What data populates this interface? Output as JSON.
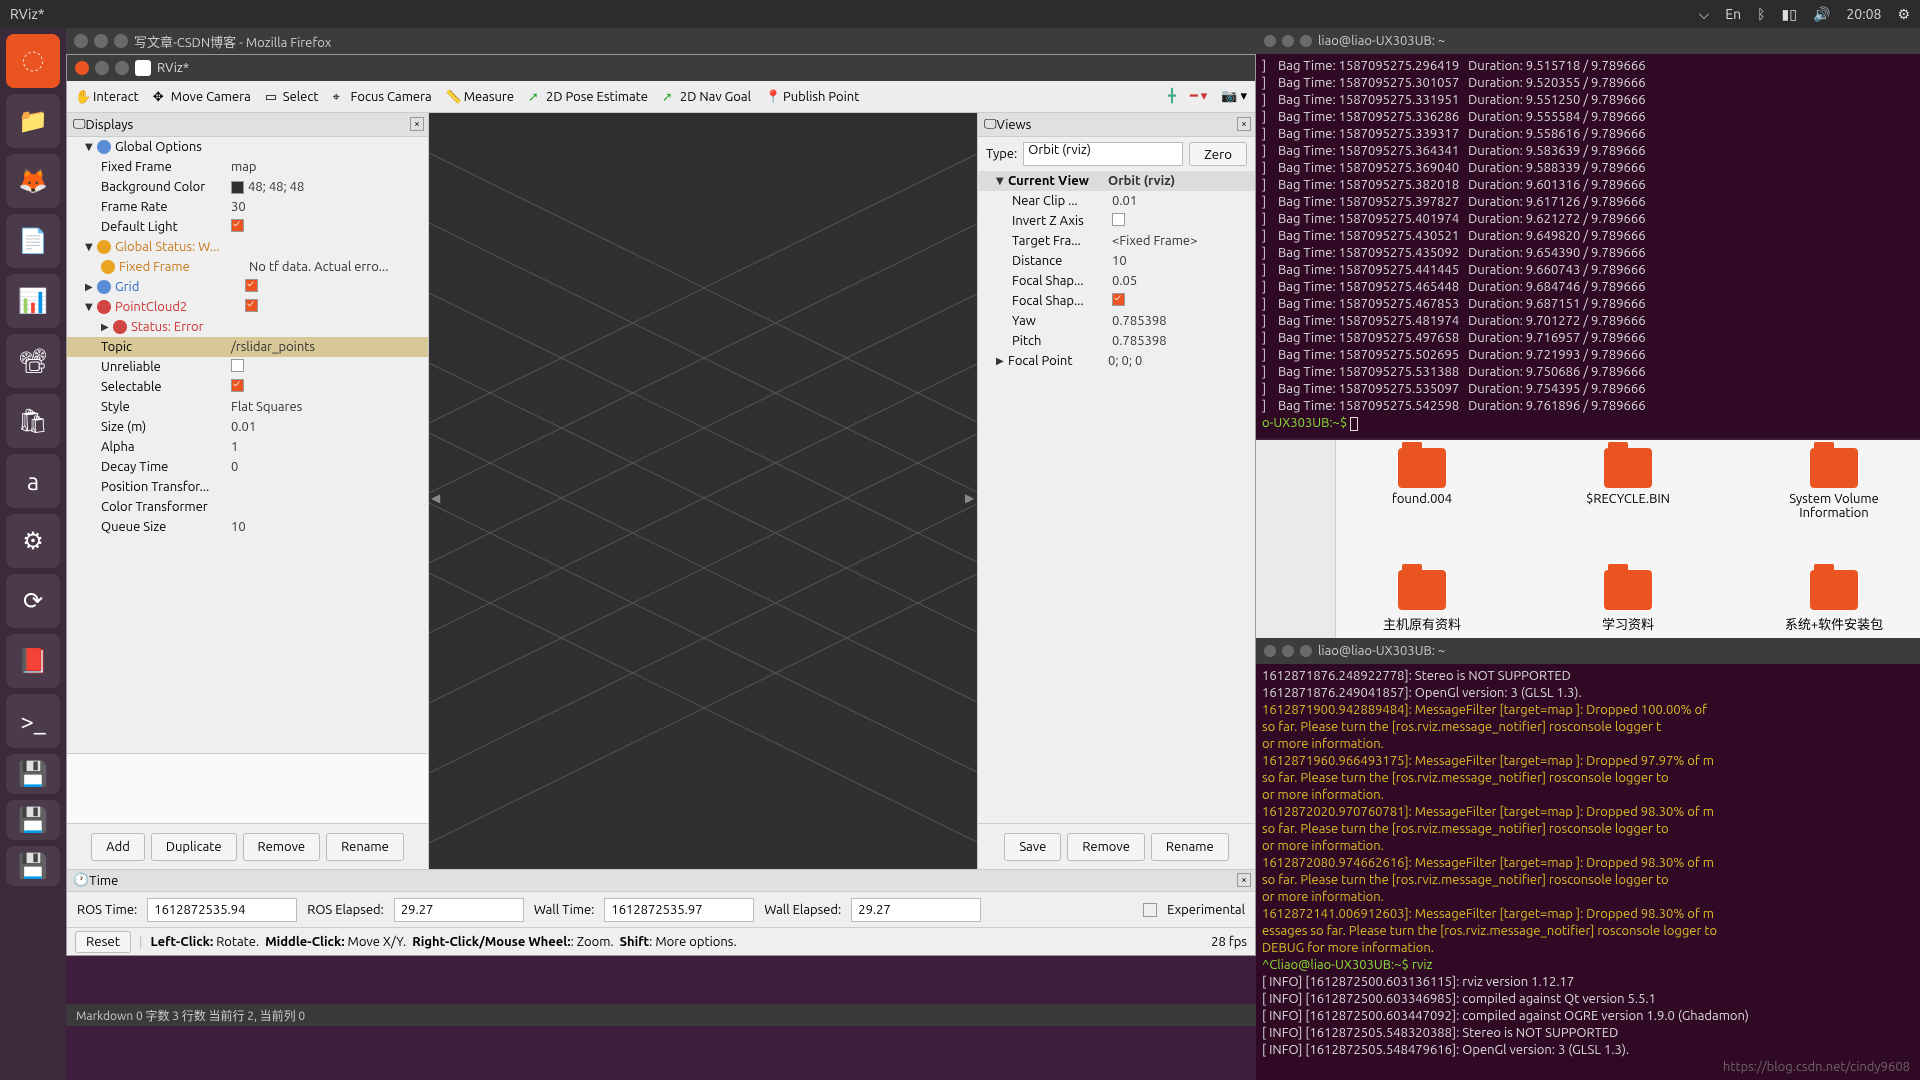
{
  "menubar": {
    "title": "RViz*",
    "clock": "20:08",
    "lang": "En"
  },
  "firefox": {
    "title": "写文章-CSDN博客 - Mozilla Firefox"
  },
  "rviz": {
    "title": "RViz*",
    "toolbar": {
      "interact": "Interact",
      "move_camera": "Move Camera",
      "select": "Select",
      "focus_camera": "Focus Camera",
      "measure": "Measure",
      "pose_estimate": "2D Pose Estimate",
      "nav_goal": "2D Nav Goal",
      "publish_point": "Publish Point"
    },
    "displays": {
      "header": "Displays",
      "global_options": "Global Options",
      "fixed_frame_lbl": "Fixed Frame",
      "fixed_frame_val": "map",
      "bg_lbl": "Background Color",
      "bg_val": "48; 48; 48",
      "frame_rate_lbl": "Frame Rate",
      "frame_rate_val": "30",
      "default_light_lbl": "Default Light",
      "global_status": "Global Status: W...",
      "fixed_frame2": "Fixed Frame",
      "fixed_frame2_val": "No tf data.  Actual erro...",
      "grid": "Grid",
      "pointcloud": "PointCloud2",
      "status_error": "Status: Error",
      "topic_lbl": "Topic",
      "topic_val": "/rslidar_points",
      "unreliable_lbl": "Unreliable",
      "selectable_lbl": "Selectable",
      "style_lbl": "Style",
      "style_val": "Flat Squares",
      "size_lbl": "Size (m)",
      "size_val": "0.01",
      "alpha_lbl": "Alpha",
      "alpha_val": "1",
      "decay_lbl": "Decay Time",
      "decay_val": "0",
      "pos_trans_lbl": "Position Transfor...",
      "color_trans_lbl": "Color Transformer",
      "queue_lbl": "Queue Size",
      "queue_val": "10",
      "add": "Add",
      "duplicate": "Duplicate",
      "remove": "Remove",
      "rename": "Rename"
    },
    "views": {
      "header": "Views",
      "type_lbl": "Type:",
      "type_val": "Orbit (rviz)",
      "zero": "Zero",
      "current_view": "Current View",
      "current_view_val": "Orbit (rviz)",
      "near_clip_lbl": "Near Clip ...",
      "near_clip_val": "0.01",
      "invert_z_lbl": "Invert Z Axis",
      "target_frame_lbl": "Target Fra...",
      "target_frame_val": "<Fixed Frame>",
      "distance_lbl": "Distance",
      "distance_val": "10",
      "focal_shape_size_lbl": "Focal Shap...",
      "focal_shape_size_val": "0.05",
      "focal_shape_fixed_lbl": "Focal Shap...",
      "yaw_lbl": "Yaw",
      "yaw_val": "0.785398",
      "pitch_lbl": "Pitch",
      "pitch_val": "0.785398",
      "focal_point_lbl": "Focal Point",
      "focal_point_val": "0; 0; 0",
      "save": "Save",
      "remove": "Remove",
      "rename": "Rename"
    },
    "time": {
      "header": "Time",
      "ros_time_lbl": "ROS Time:",
      "ros_time_val": "1612872535.94",
      "ros_elapsed_lbl": "ROS Elapsed:",
      "ros_elapsed_val": "29.27",
      "wall_time_lbl": "Wall Time:",
      "wall_time_val": "1612872535.97",
      "wall_elapsed_lbl": "Wall Elapsed:",
      "wall_elapsed_val": "29.27",
      "experimental": "Experimental"
    },
    "status": {
      "reset": "Reset",
      "hint": "Left-Click: Rotate.  Middle-Click: Move X/Y.  Right-Click/Mouse Wheel:: Zoom.  Shift: More options.",
      "fps": "28 fps"
    }
  },
  "editor_bar": "Markdown  0 字数  3 行数   当前行 2, 当前列 0",
  "term1": {
    "title": "liao@liao-UX303UB: ~",
    "lines": [
      "]    Bag Time: 1587095275.296419   Duration: 9.515718 / 9.789666",
      "]    Bag Time: 1587095275.301057   Duration: 9.520355 / 9.789666",
      "]    Bag Time: 1587095275.331951   Duration: 9.551250 / 9.789666",
      "]    Bag Time: 1587095275.336286   Duration: 9.555584 / 9.789666",
      "]    Bag Time: 1587095275.339317   Duration: 9.558616 / 9.789666",
      "]    Bag Time: 1587095275.364341   Duration: 9.583639 / 9.789666",
      "]    Bag Time: 1587095275.369040   Duration: 9.588339 / 9.789666",
      "]    Bag Time: 1587095275.382018   Duration: 9.601316 / 9.789666",
      "]    Bag Time: 1587095275.397827   Duration: 9.617126 / 9.789666",
      "]    Bag Time: 1587095275.401974   Duration: 9.621272 / 9.789666",
      "]    Bag Time: 1587095275.430521   Duration: 9.649820 / 9.789666",
      "]    Bag Time: 1587095275.435092   Duration: 9.654390 / 9.789666",
      "]    Bag Time: 1587095275.441445   Duration: 9.660743 / 9.789666",
      "]    Bag Time: 1587095275.465448   Duration: 9.684746 / 9.789666",
      "]    Bag Time: 1587095275.467853   Duration: 9.687151 / 9.789666",
      "]    Bag Time: 1587095275.481974   Duration: 9.701272 / 9.789666",
      "]    Bag Time: 1587095275.497658   Duration: 9.716957 / 9.789666",
      "]    Bag Time: 1587095275.502695   Duration: 9.721993 / 9.789666",
      "]    Bag Time: 1587095275.531388   Duration: 9.750686 / 9.789666",
      "]    Bag Time: 1587095275.535097   Duration: 9.754395 / 9.789666",
      "]    Bag Time: 1587095275.542598   Duration: 9.761896 / 9.789666"
    ],
    "prompt": "o-UX303UB:~$ "
  },
  "naut": {
    "items1": [
      "found.004",
      "$RECYCLE.BIN",
      "System Volume Information"
    ],
    "items2": [
      "主机原有资料",
      "学习资料",
      "系统+软件安装包"
    ]
  },
  "term2": {
    "title": "liao@liao-UX303UB: ~",
    "lines": [
      {
        "c": "info",
        "t": "1612871876.248922778]: Stereo is NOT SUPPORTED"
      },
      {
        "c": "info",
        "t": "1612871876.249041857]: OpenGl version: 3 (GLSL 1.3)."
      },
      {
        "c": "warn",
        "t": "1612871900.942889484]: MessageFilter [target=map ]: Dropped 100.00% of"
      },
      {
        "c": "warn",
        "t": "so far. Please turn the [ros.rviz.message_notifier] rosconsole logger t"
      },
      {
        "c": "warn",
        "t": "or more information."
      },
      {
        "c": "warn",
        "t": "1612871960.966493175]: MessageFilter [target=map ]: Dropped 97.97% of m"
      },
      {
        "c": "warn",
        "t": "so far. Please turn the [ros.rviz.message_notifier] rosconsole logger to"
      },
      {
        "c": "warn",
        "t": "or more information."
      },
      {
        "c": "warn",
        "t": "1612872020.970760781]: MessageFilter [target=map ]: Dropped 98.30% of m"
      },
      {
        "c": "warn",
        "t": "so far. Please turn the [ros.rviz.message_notifier] rosconsole logger to"
      },
      {
        "c": "warn",
        "t": "or more information."
      },
      {
        "c": "warn",
        "t": "1612872080.974662616]: MessageFilter [target=map ]: Dropped 98.30% of m"
      },
      {
        "c": "warn",
        "t": "so far. Please turn the [ros.rviz.message_notifier] rosconsole logger to"
      },
      {
        "c": "warn",
        "t": "or more information."
      },
      {
        "c": "warn",
        "t": "1612872141.006912603]: MessageFilter [target=map ]: Dropped 98.30% of m"
      },
      {
        "c": "warn",
        "t": "essages so far. Please turn the [ros.rviz.message_notifier] rosconsole logger to"
      },
      {
        "c": "warn",
        "t": "DEBUG for more information."
      },
      {
        "c": "pmt",
        "t": "^Cliao@liao-UX303UB:~$ rviz"
      },
      {
        "c": "info",
        "t": "[ INFO] [1612872500.603136115]: rviz version 1.12.17"
      },
      {
        "c": "info",
        "t": "[ INFO] [1612872500.603346985]: compiled against Qt version 5.5.1"
      },
      {
        "c": "info",
        "t": "[ INFO] [1612872500.603447092]: compiled against OGRE version 1.9.0 (Ghadamon)"
      },
      {
        "c": "info",
        "t": "[ INFO] [1612872505.548320388]: Stereo is NOT SUPPORTED"
      },
      {
        "c": "info",
        "t": "[ INFO] [1612872505.548479616]: OpenGl version: 3 (GLSL 1.3)."
      }
    ]
  },
  "watermark": "https://blog.csdn.net/cindy9608"
}
